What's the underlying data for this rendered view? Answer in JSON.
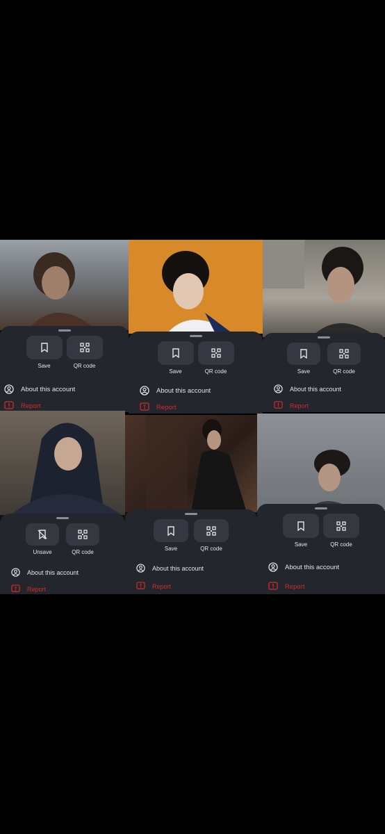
{
  "colors": {
    "background": "#000000",
    "sheet": "#23262c",
    "button": "#353841",
    "text": "#e6e6e6",
    "report": "#d42a2a"
  },
  "menu": {
    "save_label": "Save",
    "unsave_label": "Unsave",
    "qr_label": "QR code",
    "about_label": "About this account",
    "report_label": "Report"
  },
  "tiles": [
    {
      "first_button": "Save",
      "icons": [
        "bookmark-icon",
        "qr-code-icon",
        "account-circle-icon",
        "report-icon"
      ]
    },
    {
      "first_button": "Save",
      "icons": [
        "bookmark-icon",
        "qr-code-icon",
        "account-circle-icon",
        "report-icon"
      ]
    },
    {
      "first_button": "Save",
      "icons": [
        "bookmark-icon",
        "qr-code-icon",
        "account-circle-icon",
        "report-icon"
      ]
    },
    {
      "first_button": "Unsave",
      "icons": [
        "bookmark-off-icon",
        "qr-code-icon",
        "account-circle-icon",
        "report-icon"
      ]
    },
    {
      "first_button": "Save",
      "icons": [
        "bookmark-icon",
        "qr-code-icon",
        "account-circle-icon",
        "report-icon"
      ]
    },
    {
      "first_button": "Save",
      "icons": [
        "bookmark-icon",
        "qr-code-icon",
        "account-circle-icon",
        "report-icon"
      ]
    }
  ]
}
